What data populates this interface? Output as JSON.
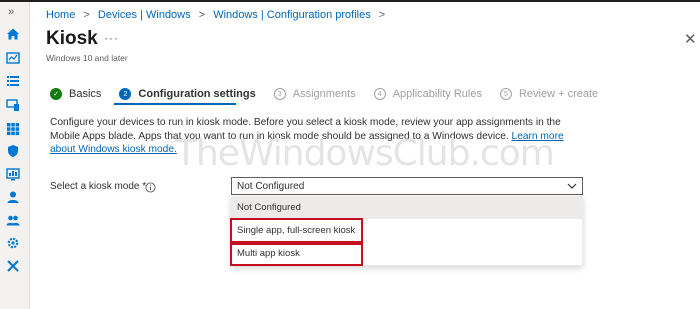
{
  "breadcrumb": {
    "items": [
      "Home",
      "Devices | Windows",
      "Windows | Configuration profiles"
    ],
    "separator": ">"
  },
  "page": {
    "title": "Kiosk",
    "more": "···",
    "subtitle": "Windows 10 and later",
    "close": "✕"
  },
  "steps": [
    {
      "number": "✓",
      "label": "Basics",
      "state": "done"
    },
    {
      "number": "2",
      "label": "Configuration settings",
      "state": "active"
    },
    {
      "number": "3",
      "label": "Assignments",
      "state": "pending"
    },
    {
      "number": "4",
      "label": "Applicability Rules",
      "state": "pending"
    },
    {
      "number": "5",
      "label": "Review + create",
      "state": "pending"
    }
  ],
  "description": {
    "text": "Configure your devices to run in kiosk mode. Before you select a kiosk mode, review your app assignments in the Mobile Apps blade. Apps that you want to run in kiosk mode should be assigned to a Windows device. ",
    "link": "Learn more about Windows kiosk mode."
  },
  "watermark": "TheWindowsClub.com",
  "kiosk_field": {
    "label": "Select a kiosk mode *",
    "value": "Not Configured",
    "options": [
      "Not Configured",
      "Single app, full-screen kiosk",
      "Multi app kiosk"
    ]
  },
  "colors": {
    "accent": "#0067b8",
    "success": "#107c10",
    "highlight": "#c50f1f"
  },
  "rail_icons": [
    "home-icon",
    "dashboard-icon",
    "list-icon",
    "devices-icon",
    "apps-icon",
    "security-icon",
    "reports-icon",
    "user-icon",
    "groups-icon",
    "settings-icon",
    "tools-icon"
  ]
}
